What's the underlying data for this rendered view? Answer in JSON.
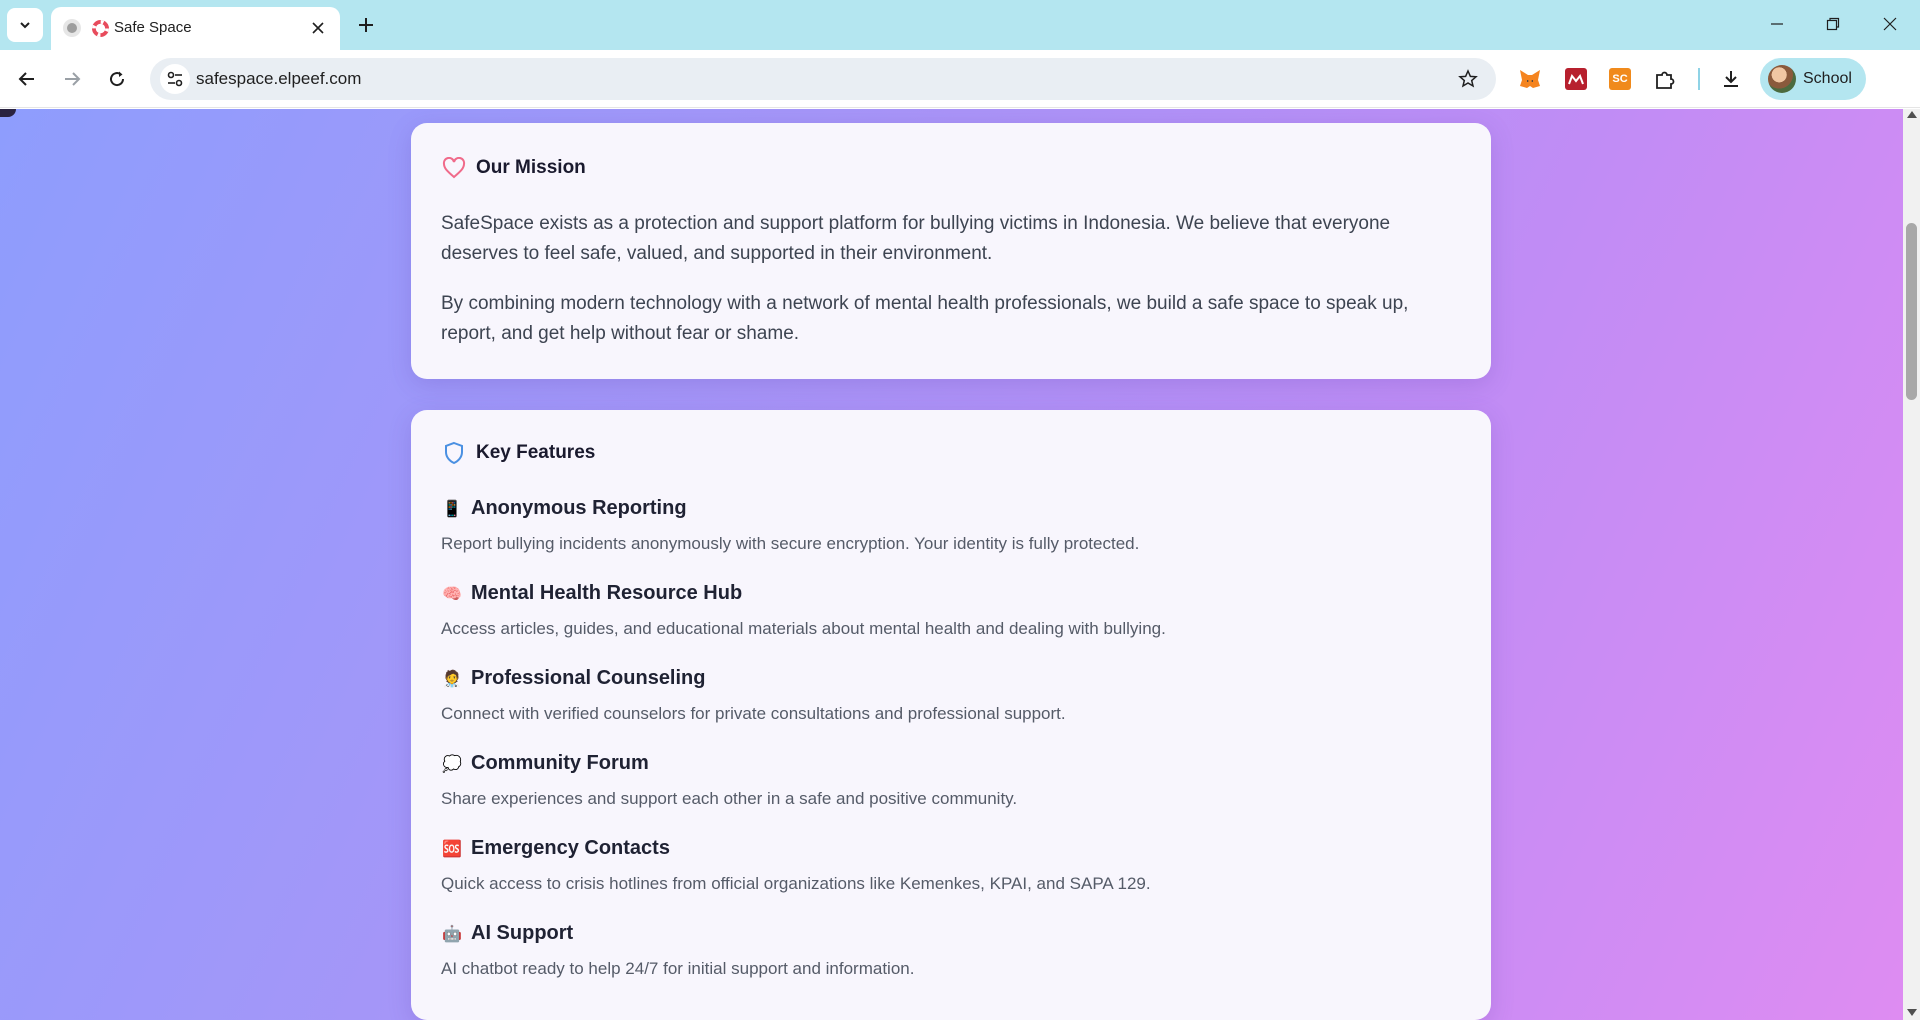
{
  "browser": {
    "tab_title": "Safe Space",
    "url": "safespace.elpeef.com",
    "profile_name": "School",
    "extensions": [
      {
        "name": "metamask-fox-icon"
      },
      {
        "name": "red-extension-icon"
      },
      {
        "name": "sc-extension-icon",
        "text": "SC"
      },
      {
        "name": "puzzle-extensions-icon"
      }
    ]
  },
  "mission": {
    "heading": "Our Mission",
    "paragraphs": [
      "SafeSpace exists as a protection and support platform for bullying victims in Indonesia. We believe that everyone deserves to feel safe, valued, and supported in their environment.",
      "By combining modern technology with a network of mental health professionals, we build a safe space to speak up, report, and get help without fear or shame."
    ]
  },
  "features": {
    "heading": "Key Features",
    "items": [
      {
        "emoji": "📱",
        "icon": "phone-icon",
        "title": "Anonymous Reporting",
        "desc": "Report bullying incidents anonymously with secure encryption. Your identity is fully protected."
      },
      {
        "emoji": "🧠",
        "icon": "brain-icon",
        "title": "Mental Health Resource Hub",
        "desc": "Access articles, guides, and educational materials about mental health and dealing with bullying."
      },
      {
        "emoji": "🧑‍⚕️",
        "icon": "counselor-icon",
        "title": "Professional Counseling",
        "desc": "Connect with verified counselors for private consultations and professional support."
      },
      {
        "emoji": "💭",
        "icon": "speech-bubble-icon",
        "title": "Community Forum",
        "desc": "Share experiences and support each other in a safe and positive community."
      },
      {
        "emoji": "🆘",
        "icon": "sos-icon",
        "title": "Emergency Contacts",
        "desc": "Quick access to crisis hotlines from official organizations like Kemenkes, KPAI, and SAPA 129."
      },
      {
        "emoji": "🤖",
        "icon": "robot-icon",
        "title": "AI Support",
        "desc": "AI chatbot ready to help 24/7 for initial support and information."
      }
    ]
  },
  "colors": {
    "gradient_start": "#8e9dfd",
    "gradient_end": "#de8cf2",
    "heart": "#f06a8a",
    "shield": "#4a90e2",
    "tabbar": "#b4e6f0"
  }
}
